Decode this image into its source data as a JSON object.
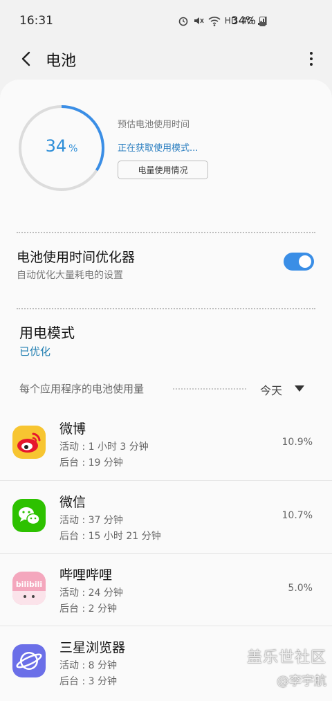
{
  "status_bar": {
    "time": "16:31",
    "icons": [
      "alarm-icon",
      "mute-icon",
      "wifi-icon",
      "hd-icon",
      "4g-icon",
      "signal-icon"
    ],
    "hd_label": "HD",
    "net_label": "4G",
    "battery_percent_text": "34%"
  },
  "appbar": {
    "title": "电池"
  },
  "battery": {
    "level": 34,
    "level_num": "34",
    "level_unit": "%",
    "estimate_label": "预估电池使用时间",
    "estimate_status": "正在获取使用模式...",
    "usage_button": "电量使用情况",
    "accent": "#3a8ee6"
  },
  "optimizer": {
    "title": "电池使用时间优化器",
    "subtitle": "自动优化大量耗电的设置",
    "enabled": true
  },
  "power_mode": {
    "title": "用电模式",
    "value": "已优化"
  },
  "usage_section": {
    "title": "每个应用程序的电池使用量",
    "period": "今天"
  },
  "apps": [
    {
      "name": "微博",
      "active": "活动 : 1 小时 3 分钟",
      "background": "后台 : 19 分钟",
      "percent": "10.9%",
      "icon": "weibo-icon"
    },
    {
      "name": "微信",
      "active": "活动 : 37 分钟",
      "background": "后台 : 15 小时 21 分钟",
      "percent": "10.7%",
      "icon": "wechat-icon"
    },
    {
      "name": "哔哩哔哩",
      "active": "活动 : 24 分钟",
      "background": "后台 : 2 分钟",
      "percent": "5.0%",
      "icon": "bilibili-icon",
      "icon_text": "bilibili"
    },
    {
      "name": "三星浏览器",
      "active": "活动 : 8 分钟",
      "background": "后台 : 3 分钟",
      "percent": "",
      "icon": "samsung-browser-icon"
    }
  ],
  "watermark": {
    "line1": "盖乐世社区",
    "line2": "@李宇航"
  }
}
